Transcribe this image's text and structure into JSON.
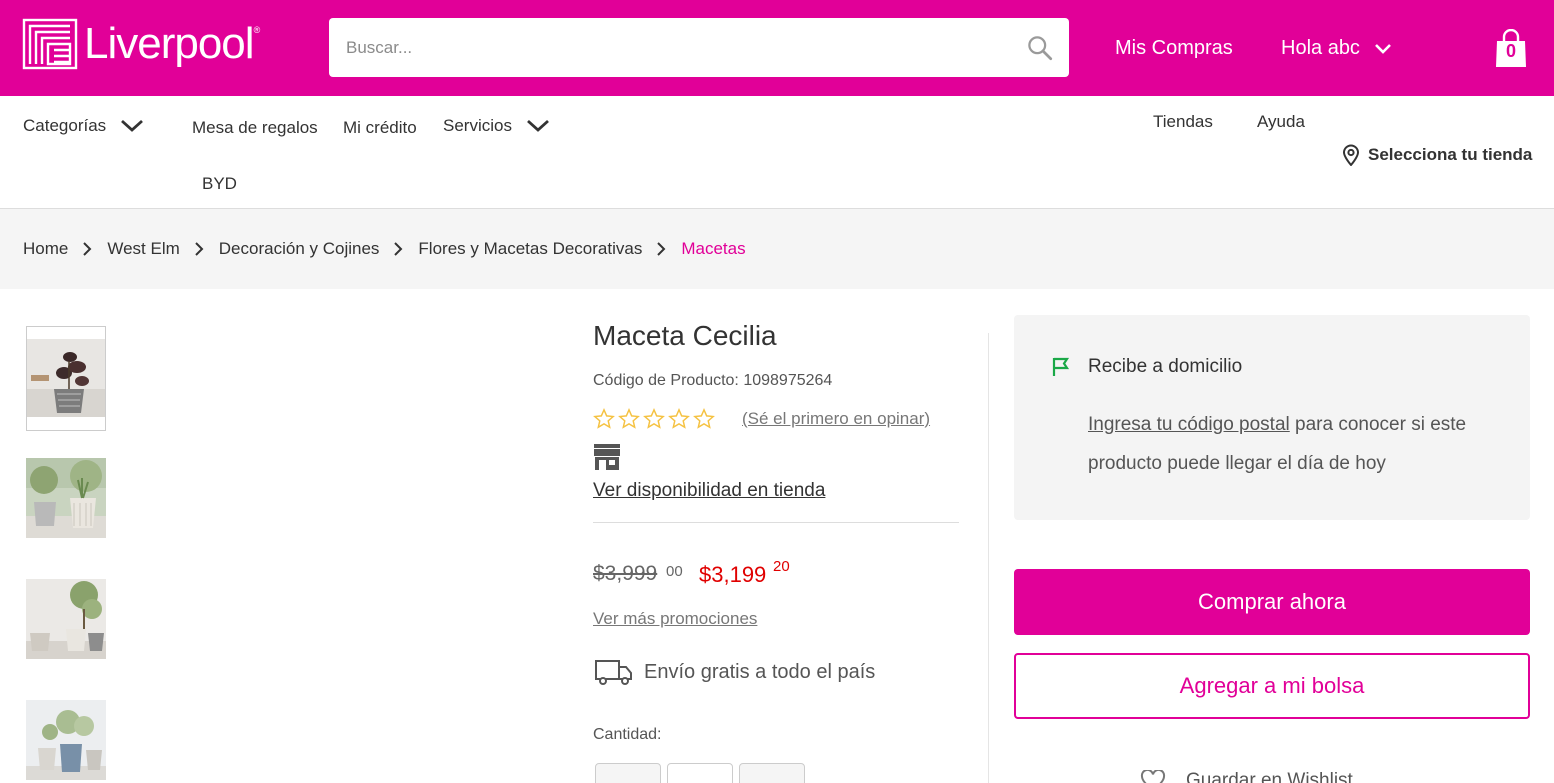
{
  "header": {
    "logo_text": "Liverpool",
    "logo_reg": "®",
    "search_placeholder": "Buscar...",
    "mis_compras": "Mis Compras",
    "greeting": "Hola abc",
    "bag_count": "0"
  },
  "nav": {
    "categorias": "Categorías",
    "mesa": "Mesa de regalos",
    "credito": "Mi crédito",
    "servicios": "Servicios",
    "byd": "BYD",
    "tiendas": "Tiendas",
    "ayuda": "Ayuda",
    "select_store": "Selecciona tu tienda"
  },
  "breadcrumb": [
    "Home",
    "West Elm",
    "Decoración y Cojines",
    "Flores y Macetas Decorativas",
    "Macetas"
  ],
  "product": {
    "title": "Maceta Cecilia",
    "code": "Código de Producto: 1098975264",
    "rating_stars": 0,
    "rating_link": "(Sé el primero en opinar)",
    "availability_link": "Ver disponibilidad en tienda",
    "old_price": "$3,999",
    "old_cents": "00",
    "new_price": "$3,199",
    "new_cents": "20",
    "promos_link": "Ver más promociones",
    "shipping": "Envío gratis a todo el país",
    "quantity_label": "Cantidad:"
  },
  "delivery": {
    "title": "Recibe a domicilio",
    "postal_link": "Ingresa tu código postal",
    "text_rest": " para conocer si este producto puede llegar el día de hoy"
  },
  "actions": {
    "buy_now": "Comprar ahora",
    "add_to_bag": "Agregar a mi bolsa",
    "wishlist": "Guardar en Wishlist"
  },
  "colors": {
    "brand": "#e10098",
    "sale_price": "#e00000",
    "star": "#f5c242",
    "flag": "#1aa847"
  }
}
